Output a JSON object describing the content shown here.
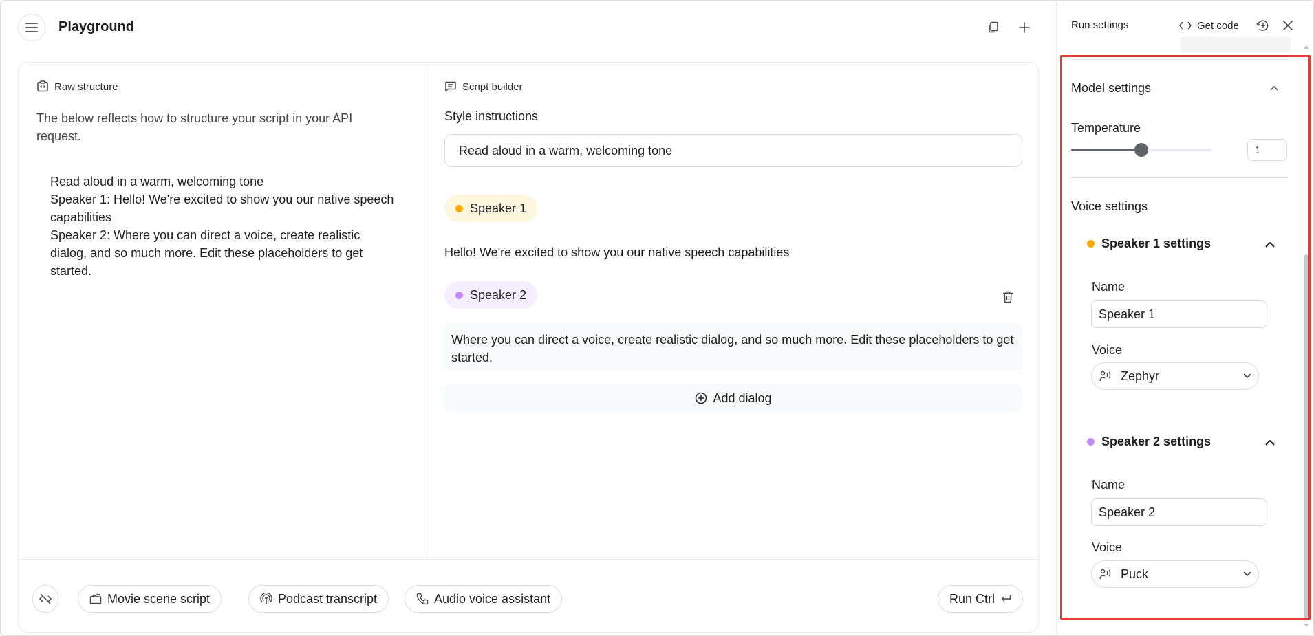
{
  "header": {
    "title": "Playground",
    "menu_icon": "menu-icon",
    "compare_icon": "copy-icon",
    "new_icon": "plus-icon"
  },
  "raw_structure": {
    "label": "Raw structure",
    "description": "The below reflects how to structure your script in your API request.",
    "script_lines": [
      "Read aloud in a warm, welcoming tone",
      "Speaker 1: Hello! We're excited to show you our native speech capabilities",
      "Speaker 2: Where you can direct a voice, create realistic dialog, and so much more. Edit these placeholders to get started."
    ]
  },
  "script_builder": {
    "label": "Script builder",
    "style_label": "Style instructions",
    "style_value": "Read aloud in a warm, welcoming tone",
    "speakers": [
      {
        "name": "Speaker 1",
        "color": "#f9ab00",
        "bg": "#fef7e0",
        "text": "Hello! We're excited to show you our native speech capabilities"
      },
      {
        "name": "Speaker 2",
        "color": "#c58af9",
        "bg": "#f6efff",
        "text": "Where you can direct a voice, create realistic dialog, and so much more. Edit these placeholders to get started."
      }
    ],
    "add_dialog_label": "Add dialog"
  },
  "toolbar": {
    "presets": [
      "Movie scene script",
      "Podcast transcript",
      "Audio voice assistant"
    ],
    "run_label": "Run Ctrl"
  },
  "run_settings": {
    "title": "Run settings",
    "get_code_label": "Get code",
    "model_settings": {
      "title": "Model settings",
      "temperature_label": "Temperature",
      "temperature_value": "1",
      "temperature_fraction": 0.5
    },
    "voice_settings": {
      "title": "Voice settings",
      "speakers": [
        {
          "title": "Speaker 1 settings",
          "name_label": "Name",
          "name_value": "Speaker 1",
          "voice_label": "Voice",
          "voice_value": "Zephyr",
          "color": "#f9ab00"
        },
        {
          "title": "Speaker 2 settings",
          "name_label": "Name",
          "name_value": "Speaker 2",
          "voice_label": "Voice",
          "voice_value": "Puck",
          "color": "#c58af9"
        }
      ]
    }
  },
  "colors": {
    "highlight": "#e53935",
    "speaker1": "#f9ab00",
    "speaker2": "#c58af9"
  }
}
